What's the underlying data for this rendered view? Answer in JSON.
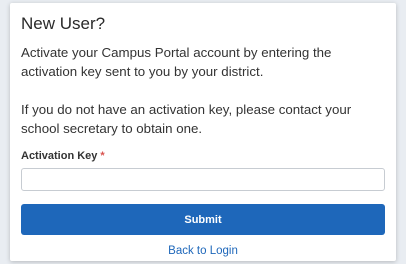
{
  "card": {
    "title": "New User?",
    "paragraph1": "Activate your Campus Portal account by entering the activation key sent to you by your district.",
    "paragraph2": "If you do not have an activation key, please contact your school secretary to obtain one."
  },
  "form": {
    "activation_key_label": "Activation Key",
    "required_marker": "*",
    "activation_key_value": "",
    "activation_key_placeholder": "",
    "submit_label": "Submit",
    "back_link": "Back to Login"
  },
  "colors": {
    "primary": "#1e67ba",
    "required": "#d9534f"
  }
}
